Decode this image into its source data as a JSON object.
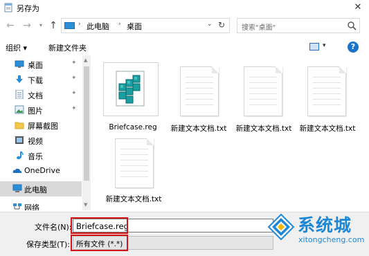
{
  "window": {
    "title": "另存为"
  },
  "nav": {
    "back": "←",
    "forward": "→",
    "up": "↑"
  },
  "address": {
    "crumbs": [
      "此电脑",
      "桌面"
    ],
    "separator": "›",
    "dropdown": "⌄",
    "refresh": "↻"
  },
  "search": {
    "placeholder": "搜索\"桌面\""
  },
  "toolbar": {
    "organize": "组织 ▾",
    "new_folder": "新建文件夹",
    "view_dropdown": "▾",
    "help": "?"
  },
  "sidebar": {
    "items": [
      {
        "label": "桌面",
        "icon": "desktop-icon",
        "pinned": true
      },
      {
        "label": "下载",
        "icon": "download-icon",
        "pinned": true
      },
      {
        "label": "文档",
        "icon": "document-icon",
        "pinned": true
      },
      {
        "label": "图片",
        "icon": "picture-icon",
        "pinned": true
      },
      {
        "label": "屏幕截图",
        "icon": "folder-icon",
        "pinned": false
      },
      {
        "label": "视频",
        "icon": "video-icon",
        "pinned": false
      },
      {
        "label": "音乐",
        "icon": "music-icon",
        "pinned": false
      },
      {
        "label": "OneDrive",
        "icon": "onedrive-icon",
        "pinned": false
      },
      {
        "label": "此电脑",
        "icon": "pc-icon",
        "pinned": false,
        "selected": true
      },
      {
        "label": "网络",
        "icon": "network-icon",
        "pinned": false
      }
    ],
    "pin_glyph": "📌"
  },
  "files": [
    {
      "name": "Briefcase.reg",
      "type": "reg"
    },
    {
      "name": "新建文本文档.txt",
      "type": "txt"
    },
    {
      "name": "新建文本文档.txt",
      "type": "txt"
    },
    {
      "name": "新建文本文档.txt",
      "type": "txt"
    },
    {
      "name": "新建文本文档.txt",
      "type": "txt"
    }
  ],
  "save": {
    "filename_label": "文件名(N):",
    "filename_value": "Briefcase.reg",
    "filetype_label": "保存类型(T):",
    "filetype_value": "所有文件 (*.*)"
  },
  "watermark": {
    "brand": "系统城",
    "url": "xitongcheng.com"
  },
  "colors": {
    "accent": "#1e88d6",
    "highlight_border": "#d41414",
    "selected_bg": "#d9d9d9"
  }
}
